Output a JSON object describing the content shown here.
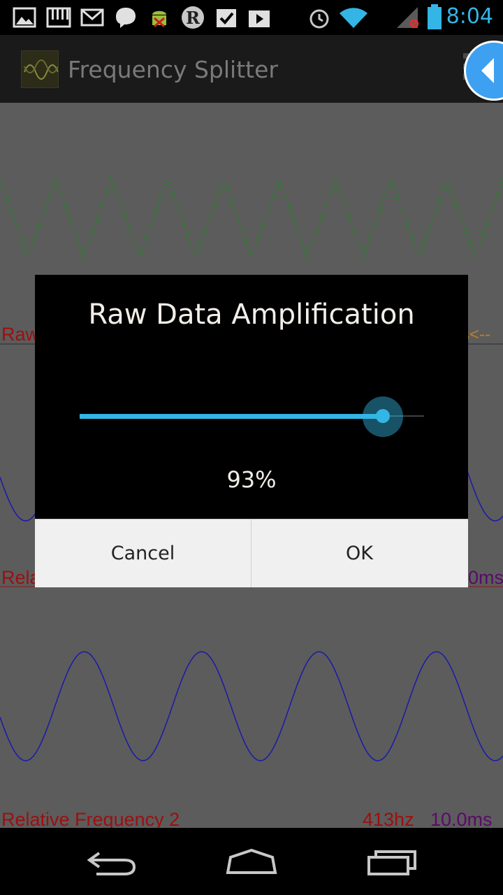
{
  "status_bar": {
    "time": "8:04",
    "icons": [
      "gallery-icon",
      "piano-icon",
      "gmail-icon",
      "viber-icon",
      "android-debug-icon",
      "r-app-icon",
      "tasks-icon",
      "play-store-icon",
      "alarm-icon",
      "wifi-icon",
      "signal-icon",
      "battery-icon"
    ]
  },
  "action_bar": {
    "title": "Frequency Splitter",
    "overflow_icon": "overflow-menu-icon"
  },
  "plots": {
    "raw_label": "Raw",
    "raw_right_label": "s<--",
    "rel1_label": "Rela",
    "rel1_right_label": "0ms",
    "rel2_label": "Relative Frequency 2",
    "rel2_hz": "413hz",
    "rel2_ms": "10.0ms",
    "colors": {
      "raw": "#2e7d2e",
      "rel": "#1a1aa8",
      "label_red": "#9a1010",
      "label_purple": "#5a0a6a"
    }
  },
  "dialog": {
    "title": "Raw Data Amplification",
    "slider_value": 0.93,
    "value_text": "93%",
    "cancel_label": "Cancel",
    "ok_label": "OK",
    "accent": "#33b5e5"
  },
  "nav_bar": {
    "icons": [
      "back-icon",
      "home-icon",
      "recents-icon"
    ]
  }
}
